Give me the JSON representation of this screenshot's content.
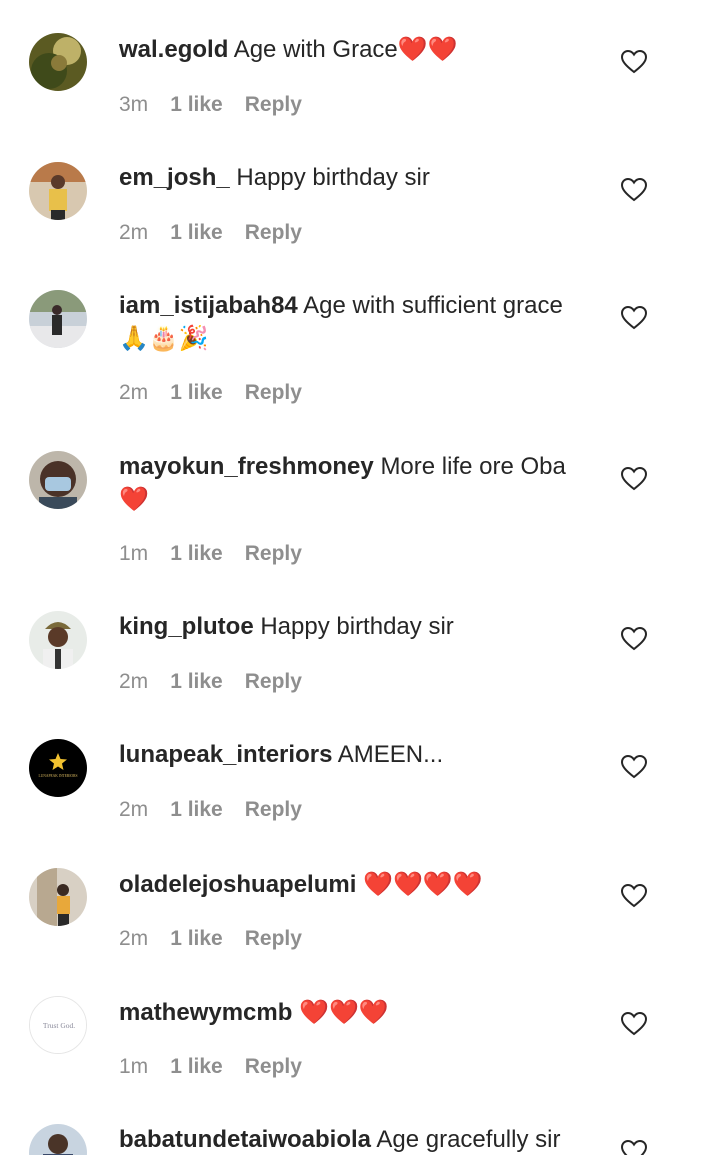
{
  "comments": [
    {
      "username": "wal.egold",
      "text": "Age with Grace",
      "emoji": "❤️❤️",
      "time": "3m",
      "likes": "1 like",
      "reply": "Reply",
      "avatar_color": "#6b6a2a"
    },
    {
      "username": "em_josh_",
      "text": "Happy birthday sir",
      "emoji": "",
      "time": "2m",
      "likes": "1 like",
      "reply": "Reply",
      "avatar_color": "#c9a15c"
    },
    {
      "username": "iam_istijabah84",
      "text": "Age with sufficient grace",
      "emoji": "🙏🎂🎉",
      "time": "2m",
      "likes": "1 like",
      "reply": "Reply",
      "avatar_color": "#8a9aa8"
    },
    {
      "username": "mayokun_freshmoney",
      "text": "More life ore Oba",
      "emoji": "❤️",
      "time": "1m",
      "likes": "1 like",
      "reply": "Reply",
      "avatar_color": "#6f5a4a"
    },
    {
      "username": "king_plutoe",
      "text": "Happy birthday sir",
      "emoji": "",
      "time": "2m",
      "likes": "1 like",
      "reply": "Reply",
      "avatar_color": "#9a8a70"
    },
    {
      "username": "lunapeak_interiors",
      "text": "AMEEN...",
      "emoji": "",
      "time": "2m",
      "likes": "1 like",
      "reply": "Reply",
      "avatar_color": "#000000",
      "avatar_caption": "LUNAPEAK INTERIORS"
    },
    {
      "username": "oladelejoshuapelumi",
      "text": "",
      "emoji": "❤️❤️❤️❤️",
      "time": "2m",
      "likes": "1 like",
      "reply": "Reply",
      "avatar_color": "#c7b8a4"
    },
    {
      "username": "mathewymcmb",
      "text": "",
      "emoji": "❤️❤️❤️",
      "time": "1m",
      "likes": "1 like",
      "reply": "Reply",
      "avatar_color": "#ffffff",
      "avatar_caption": "Trust God."
    },
    {
      "username": "babatundetaiwoabiola",
      "text": "Age gracefully sir",
      "emoji": "",
      "time": "",
      "likes": "",
      "reply": "",
      "avatar_color": "#3a4a6a"
    }
  ],
  "colors": {
    "text": "#262626",
    "meta": "#8e8e8e",
    "heart": "#e0202e"
  }
}
